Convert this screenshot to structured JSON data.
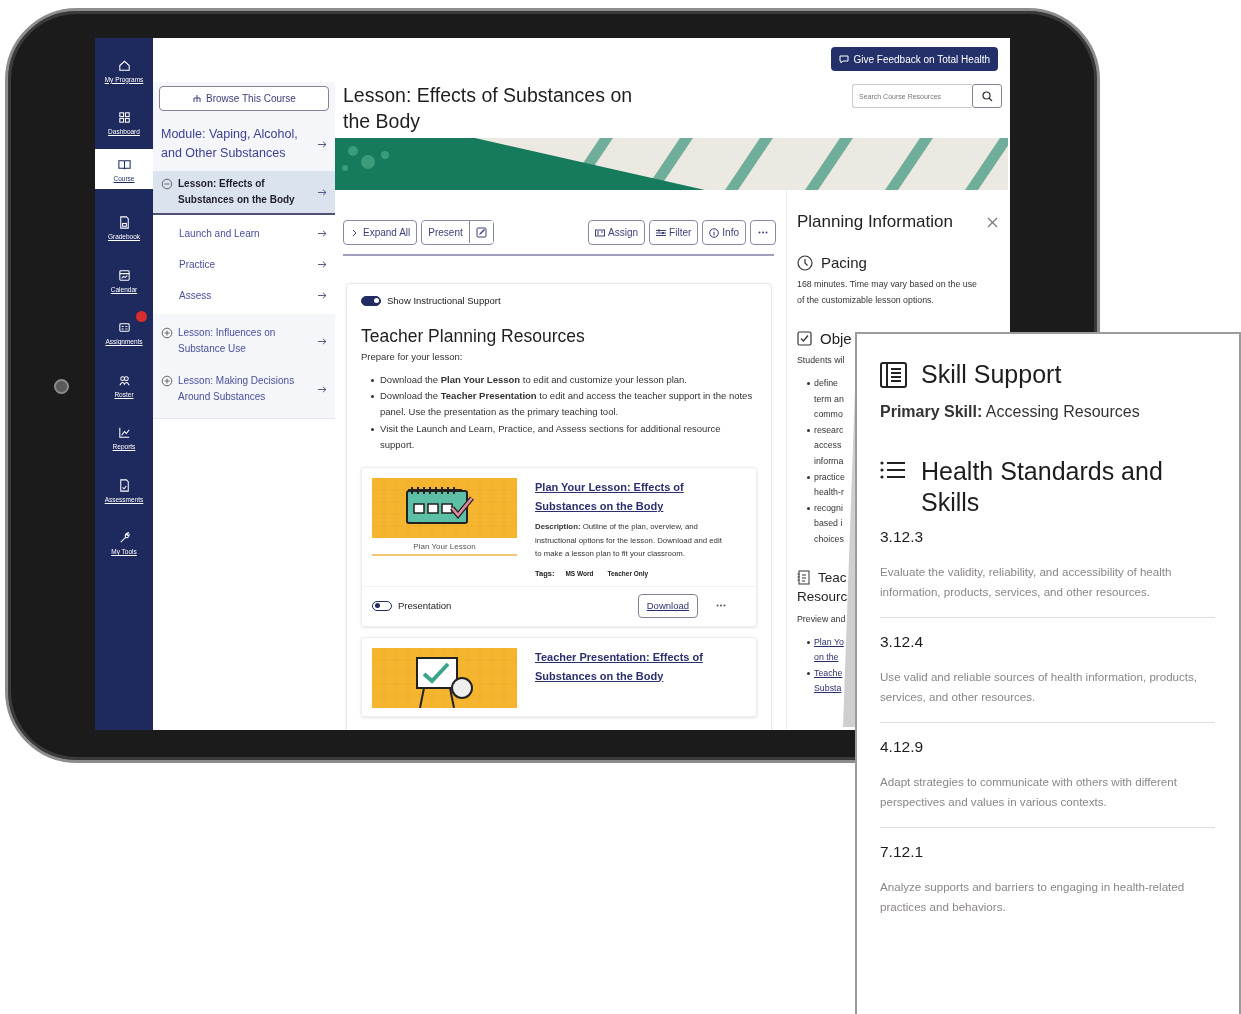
{
  "header_button": "Give Feedback on Total Health",
  "search": {
    "placeholder": "Search Course Resources"
  },
  "nav_rail": [
    {
      "label": "My Programs",
      "selected": false,
      "notification": false
    },
    {
      "label": "Dashboard",
      "selected": false,
      "notification": false
    },
    {
      "label": "Course",
      "selected": true,
      "notification": false
    },
    {
      "label": "Gradebook",
      "selected": false,
      "notification": false
    },
    {
      "label": "Calendar",
      "selected": false,
      "notification": false
    },
    {
      "label": "Assignments",
      "selected": false,
      "notification": true
    },
    {
      "label": "Roster",
      "selected": false,
      "notification": false
    },
    {
      "label": "Reports",
      "selected": false,
      "notification": false
    },
    {
      "label": "Assessments",
      "selected": false,
      "notification": false
    },
    {
      "label": "My Tools",
      "selected": false,
      "notification": false
    }
  ],
  "course_pane": {
    "browse_button": "Browse This Course",
    "module": "Module: Vaping, Alcohol, and Other Substances",
    "lessons": [
      {
        "title": "Lesson: Effects of Substances on the Body",
        "selected": true,
        "expanded": true,
        "children": [
          {
            "title": "Launch and Learn",
            "selected": false
          },
          {
            "title": "Practice",
            "selected": false
          },
          {
            "title": "Assess",
            "selected": false
          }
        ]
      },
      {
        "title": "Lesson: Influences on Substance Use",
        "selected": false,
        "expanded": false
      },
      {
        "title": "Lesson: Making Decisions Around Substances",
        "selected": false,
        "expanded": false
      }
    ]
  },
  "lesson": {
    "title": "Lesson: Effects of Substances on the Body",
    "toolbar": [
      {
        "kind": "expand",
        "label": "Expand All"
      },
      {
        "kind": "split",
        "label": "Present"
      },
      {
        "kind": "assign",
        "label": "Assign"
      },
      {
        "kind": "filter",
        "label": "Filter"
      },
      {
        "kind": "info",
        "label": "Info"
      }
    ],
    "instructional_support": {
      "label": "Show Instructional Support",
      "on": true
    },
    "heading": "Teacher Planning Resources",
    "intro": "Prepare for your lesson:",
    "bullets": [
      "Download the **Plan Your Lesson** to edit and customize your lesson plan.",
      "Download the **Teacher Presentation** to edit and access the teacher support in the notes panel. Use the presentation as the primary teaching tool.",
      "Visit the Launch and Learn, Practice, and Assess sections for additional resource support."
    ],
    "resources": [
      {
        "kind": "plan",
        "caption": "Plan Your Lesson",
        "title": "Plan Your Lesson: Effects of Substances on the Body",
        "description": "**Description:** Outline of the plan, overview, and instructional options for the lesson. Download and edit to make a lesson plan to fit your classroom.",
        "tags_label": "Tags:",
        "tags": [
          "MS Word",
          "Teacher Only"
        ],
        "toggle": {
          "label": "Presentation",
          "on": false
        },
        "download": "Download"
      },
      {
        "kind": "presentation",
        "title": "Teacher Presentation: Effects of Substances on the Body"
      }
    ]
  },
  "planning_panel": {
    "title": "Planning Information",
    "pacing": {
      "heading": "Pacing",
      "text": "168 minutes. Time may vary based on the use of the customizable lesson options."
    },
    "objectives": {
      "heading": "Obje",
      "intro": "Students wil",
      "bullets": [
        [
          "define",
          "term an",
          "commo"
        ],
        [
          "researc",
          "access",
          "informa"
        ],
        [
          "practice",
          "health-r"
        ],
        [
          "recogni",
          "based i",
          "choices"
        ]
      ]
    },
    "teacher_resources": {
      "heading": [
        "Teac",
        "Resourc"
      ],
      "intro": "Preview and",
      "links": [
        [
          "Plan Yo",
          "on the"
        ],
        [
          "Teache",
          "Substa"
        ]
      ]
    }
  },
  "callout": {
    "skill_heading": "Skill Support",
    "primary_skill": "**Primary Skill:** Accessing Resources",
    "standards_heading": "Health Standards and Skills",
    "standards": [
      {
        "code": "3.12.3",
        "text": "Evaluate the validity, reliability, and accessibility of health information, products, services, and other resources."
      },
      {
        "code": "3.12.4",
        "text": "Use valid and reliable sources of health information, products, services, and other resources."
      },
      {
        "code": "4.12.9",
        "text": "Adapt strategies to communicate with others with different perspectives and values in various contexts."
      },
      {
        "code": "7.12.1",
        "text": "Analyze supports and barriers to engaging in health-related practices and behaviors."
      }
    ]
  }
}
